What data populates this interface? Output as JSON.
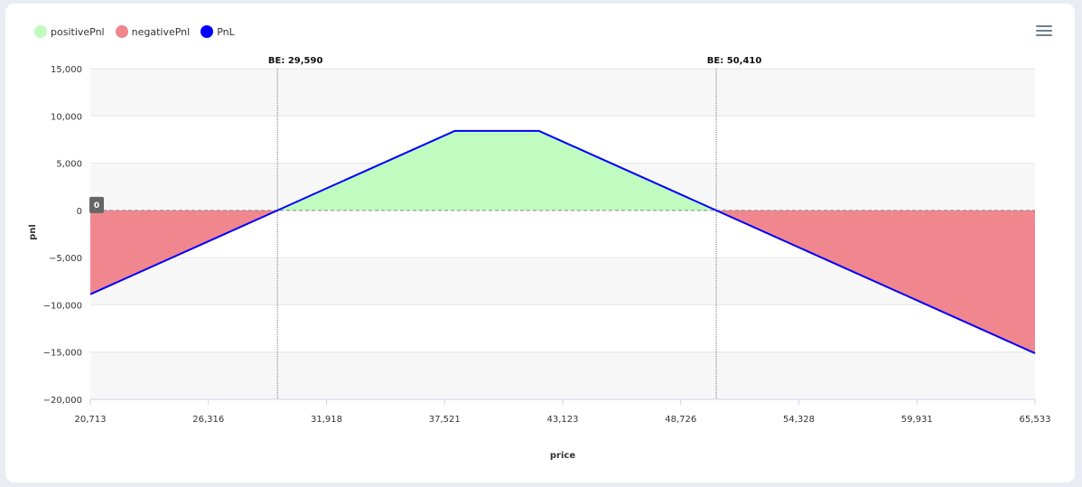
{
  "toolbar": {
    "menu_icon": "hamburger-menu-icon"
  },
  "legend": [
    {
      "label": "positivePnl",
      "color": "#c0fcc0"
    },
    {
      "label": "negativePnl",
      "color": "#f0868e"
    },
    {
      "label": "PnL",
      "color": "#0000ff"
    }
  ],
  "chart_data": {
    "type": "area",
    "xlabel": "price",
    "ylabel": "pnl",
    "xlim": [
      20713,
      65533
    ],
    "ylim": [
      -20000,
      15000
    ],
    "x_ticks": [
      "20,713",
      "26,316",
      "31,918",
      "37,521",
      "43,123",
      "48,726",
      "54,328",
      "59,931",
      "65,533"
    ],
    "y_ticks": [
      "15,000",
      "10,000",
      "5,000",
      "0",
      "−5,000",
      "−10,000",
      "−15,000",
      "−20,000"
    ],
    "y_tick_values": [
      15000,
      10000,
      5000,
      0,
      -5000,
      -10000,
      -15000,
      -20000
    ],
    "series": [
      {
        "name": "PnL",
        "color": "#0000ff",
        "x": [
          20713,
          29590,
          38000,
          42000,
          50410,
          65533
        ],
        "y": [
          -8877,
          0,
          8410,
          8410,
          0,
          -15123
        ]
      }
    ],
    "fills": {
      "positive": "#c0fcc0",
      "negative": "#f0868e"
    },
    "zero_line_label": "0",
    "annotations": [
      {
        "label": "BE: 29,590",
        "x": 29590
      },
      {
        "label": "BE: 50,410",
        "x": 50410
      }
    ],
    "grid": "horizontal-bands"
  }
}
